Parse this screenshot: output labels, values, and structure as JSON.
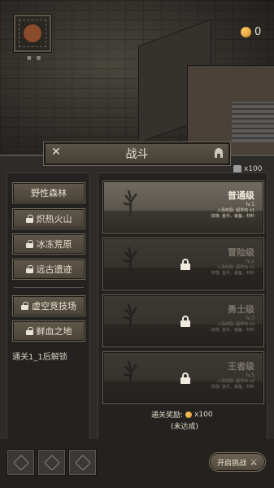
{
  "header": {
    "avatar_dots": "■ ■",
    "coins": "0"
  },
  "battle": {
    "title": "战斗",
    "close_icon": "close-icon",
    "tickets": "x100"
  },
  "regions": [
    {
      "label": "野性森林",
      "locked": false
    },
    {
      "label": "炽热火山",
      "locked": true
    },
    {
      "label": "冰冻荒原",
      "locked": true
    },
    {
      "label": "远古遗迹",
      "locked": true
    },
    {
      "label": "虚空竞技场",
      "locked": true
    },
    {
      "label": "鲜血之地",
      "locked": true
    }
  ],
  "unlock_hint": "通关1_1后解锁",
  "levels": [
    {
      "name": "普通级",
      "lv": "lv.1",
      "reward1": "入场奖励: 超界石 x1",
      "reward2": "掉落: 金币、装备、材料",
      "locked": false
    },
    {
      "name": "冒险级",
      "lv": "lv.2",
      "reward1": "入场奖励: 超界石 x1",
      "reward2": "掉落: 金币、装备、材料",
      "locked": true
    },
    {
      "name": "勇士级",
      "lv": "lv.3",
      "reward1": "入场奖励: 超界石 x1",
      "reward2": "掉落: 金币、装备、材料",
      "locked": true
    },
    {
      "name": "王者级",
      "lv": "lv.5",
      "reward1": "入场奖励: 超界石 x1",
      "reward2": "掉落: 金币、装备、材料",
      "locked": true
    }
  ],
  "clear_reward": {
    "label": "通关奖励:",
    "amount": "x100",
    "status": "(未达成)"
  },
  "start_button": "开启挑战"
}
